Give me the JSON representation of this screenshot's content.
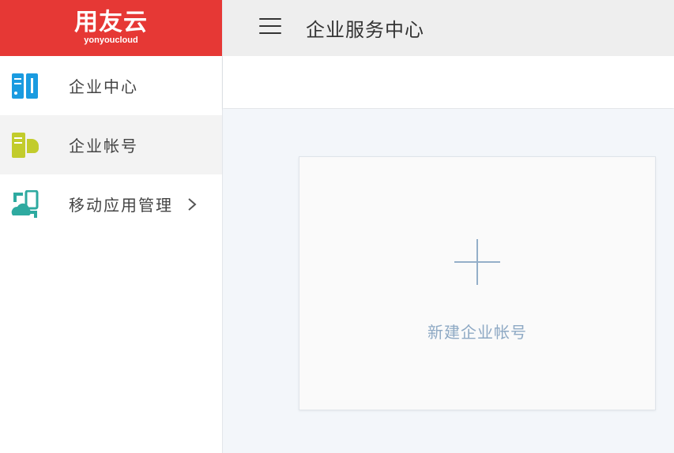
{
  "logo": {
    "cn": "用友云",
    "en": "yonyoucloud"
  },
  "header": {
    "title": "企业服务中心"
  },
  "sidebar": {
    "items": [
      {
        "label": "企业中心",
        "icon": "enterprise-center-icon"
      },
      {
        "label": "企业帐号",
        "icon": "enterprise-account-icon",
        "active": true
      },
      {
        "label": "移动应用管理",
        "icon": "mobile-app-icon",
        "has_submenu": true
      }
    ]
  },
  "main": {
    "new_account_label": "新建企业帐号"
  },
  "colors": {
    "brand": "#e63835",
    "icon_blue": "#1a9be0",
    "icon_green": "#c2cc2c",
    "icon_teal": "#2eaaa0",
    "plus": "#94afc9"
  }
}
